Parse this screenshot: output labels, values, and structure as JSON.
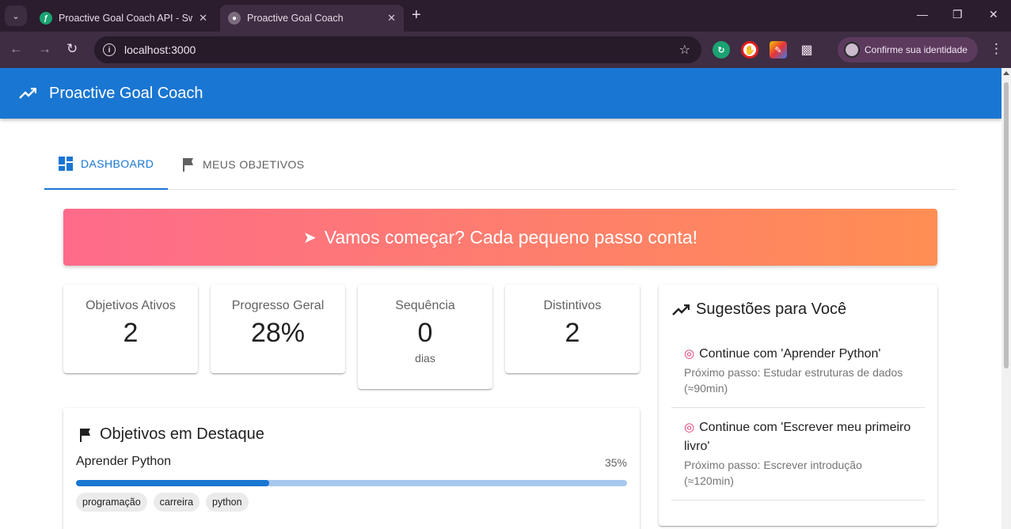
{
  "browser": {
    "tabs": [
      {
        "title": "Proactive Goal Coach API - Swa",
        "favicon_color": "#1aa372"
      },
      {
        "title": "Proactive Goal Coach",
        "favicon_color": "#7a6b7d"
      }
    ],
    "url": "localhost:3000",
    "profile_label": "Confirme sua identidade",
    "colors": {
      "frame": "#2b1d2e",
      "toolbar": "#3f2d43"
    }
  },
  "app": {
    "title": "Proactive Goal Coach",
    "primary_color": "#1976d2",
    "tabs": [
      {
        "label": "DASHBOARD",
        "icon": "dashboard-icon",
        "active": true
      },
      {
        "label": "MEUS OBJETIVOS",
        "icon": "flag-icon",
        "active": false
      }
    ],
    "banner": {
      "text": "Vamos começar? Cada pequeno passo conta!",
      "icon": "rocket-icon",
      "gradient": [
        "#fe6b8b",
        "#ff8e53"
      ]
    },
    "stats": [
      {
        "label": "Objetivos Ativos",
        "value": "2"
      },
      {
        "label": "Progresso Geral",
        "value": "28%"
      },
      {
        "label": "Sequência",
        "value": "0",
        "unit": "dias"
      },
      {
        "label": "Distintivos",
        "value": "2"
      }
    ],
    "suggestions": {
      "title": "Sugestões para Você",
      "items": [
        {
          "title": "Continue com 'Aprender Python'",
          "detail": "Próximo passo: Estudar estruturas de dados (≈90min)"
        },
        {
          "title": "Continue com 'Escrever meu primeiro livro'",
          "detail": "Próximo passo: Escrever introdução (≈120min)"
        }
      ]
    },
    "featured": {
      "title": "Objetivos em Destaque",
      "goals": [
        {
          "name": "Aprender Python",
          "progress_label": "35%",
          "progress": 0.35,
          "tags": [
            "programação",
            "carreira",
            "python"
          ]
        }
      ]
    }
  }
}
